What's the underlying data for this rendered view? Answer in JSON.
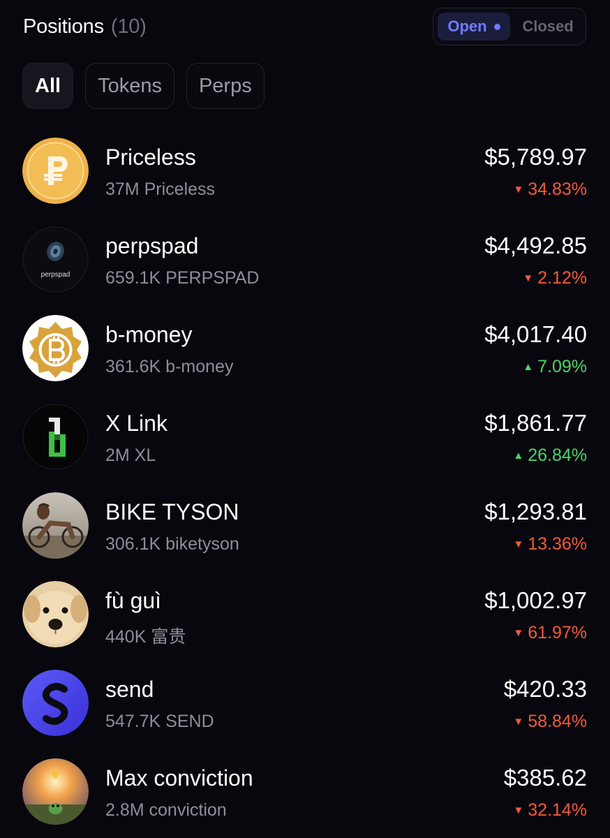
{
  "header": {
    "title": "Positions",
    "count": "(10)",
    "toggle": {
      "open_label": "Open",
      "closed_label": "Closed"
    }
  },
  "filters": [
    {
      "label": "All",
      "active": true
    },
    {
      "label": "Tokens",
      "active": false
    },
    {
      "label": "Perps",
      "active": false
    }
  ],
  "positions": [
    {
      "name": "Priceless",
      "amount": "37M Priceless",
      "value": "$5,789.97",
      "change": "34.83%",
      "direction": "down",
      "icon": "priceless-coin-icon"
    },
    {
      "name": "perpspad",
      "amount": "659.1K PERPSPAD",
      "value": "$4,492.85",
      "change": "2.12%",
      "direction": "down",
      "icon": "perpspad-logo-icon",
      "icon_text": "perpspad"
    },
    {
      "name": "b-money",
      "amount": "361.6K b-money",
      "value": "$4,017.40",
      "change": "7.09%",
      "direction": "up",
      "icon": "b-money-coin-icon"
    },
    {
      "name": "X Link",
      "amount": "2M XL",
      "value": "$1,861.77",
      "change": "26.84%",
      "direction": "up",
      "icon": "x-link-logo-icon"
    },
    {
      "name": "BIKE TYSON",
      "amount": "306.1K biketyson",
      "value": "$1,293.81",
      "change": "13.36%",
      "direction": "down",
      "icon": "bike-tyson-avatar"
    },
    {
      "name": "fù guì",
      "amount": "440K 富贵",
      "value": "$1,002.97",
      "change": "61.97%",
      "direction": "down",
      "icon": "puppy-avatar"
    },
    {
      "name": "send",
      "amount": "547.7K SEND",
      "value": "$420.33",
      "change": "58.84%",
      "direction": "down",
      "icon": "send-logo-icon"
    },
    {
      "name": "Max conviction",
      "amount": "2.8M conviction",
      "value": "$385.62",
      "change": "32.14%",
      "direction": "down",
      "icon": "max-conviction-avatar"
    }
  ],
  "colors": {
    "background": "#08070e",
    "accent": "#6f7bff",
    "down": "#f25a3a",
    "up": "#4fd466",
    "muted": "#8f8d99"
  }
}
